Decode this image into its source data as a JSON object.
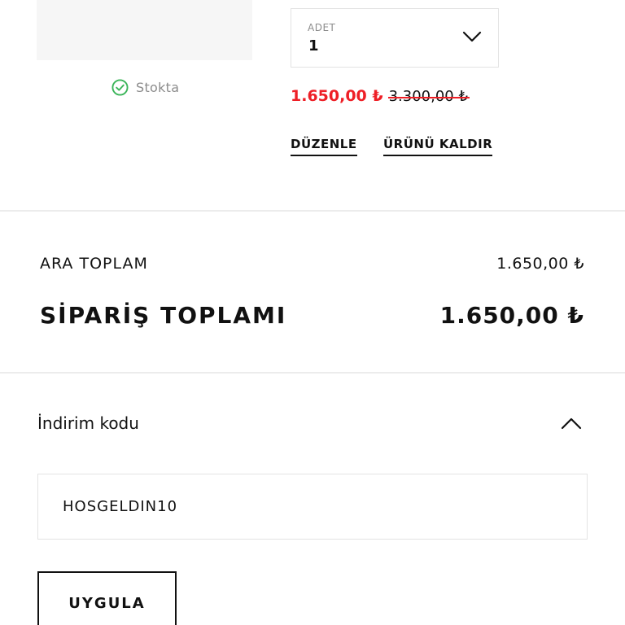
{
  "product": {
    "stock_status": "Stokta",
    "quantity": {
      "caption": "ADET",
      "value": "1"
    },
    "price": {
      "sale": "1.650,00 ₺",
      "original": "3.300,00 ₺"
    },
    "actions": {
      "edit_label": "DÜZENLE",
      "remove_label": "ÜRÜNÜ KALDIR"
    }
  },
  "summary": {
    "subtotal_label": "ARA TOPLAM",
    "subtotal_value": "1.650,00 ₺",
    "total_label": "SİPARİŞ TOPLAMI",
    "total_value": "1.650,00 ₺"
  },
  "discount": {
    "label": "İndirim kodu",
    "code_value": "HOSGELDIN10",
    "apply_label": "UYGULA",
    "expanded": true
  },
  "colors": {
    "sale_price": "#ee1f26",
    "stock_icon": "#3cb55a",
    "text": "#111111",
    "muted": "#8c8c8c",
    "border": "#e3e3e3"
  },
  "icons": {
    "stock": "check-circle-icon",
    "quantity_dropdown": "chevron-down-icon",
    "discount_toggle": "chevron-up-icon"
  }
}
